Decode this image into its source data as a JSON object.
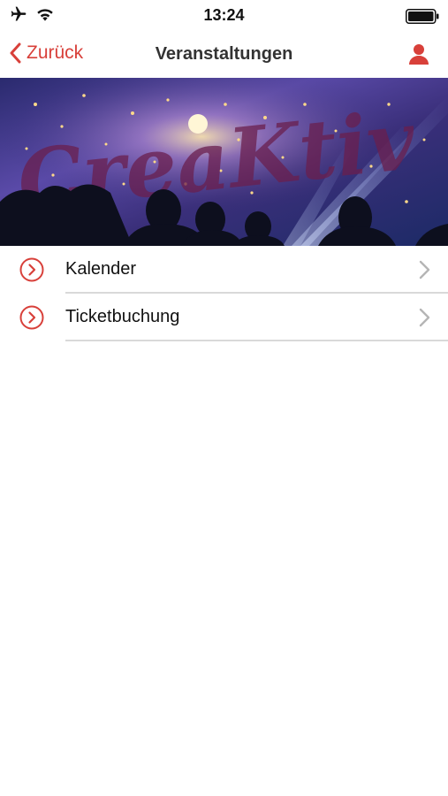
{
  "status_bar": {
    "time": "13:24",
    "icons": [
      "airplane-icon",
      "wifi-icon",
      "battery-icon"
    ]
  },
  "nav": {
    "back_label": "Zurück",
    "title": "Veranstaltungen",
    "right_icon": "user-icon"
  },
  "banner": {
    "logo_text": "CreaKtiv"
  },
  "menu": {
    "items": [
      {
        "label": "Kalender",
        "icon": "circle-chevron-right-icon"
      },
      {
        "label": "Ticketbuchung",
        "icon": "circle-chevron-right-icon"
      }
    ]
  },
  "colors": {
    "accent": "#d8403a",
    "separator": "#d9d9d9",
    "disclosure": "#b5b5b5"
  }
}
